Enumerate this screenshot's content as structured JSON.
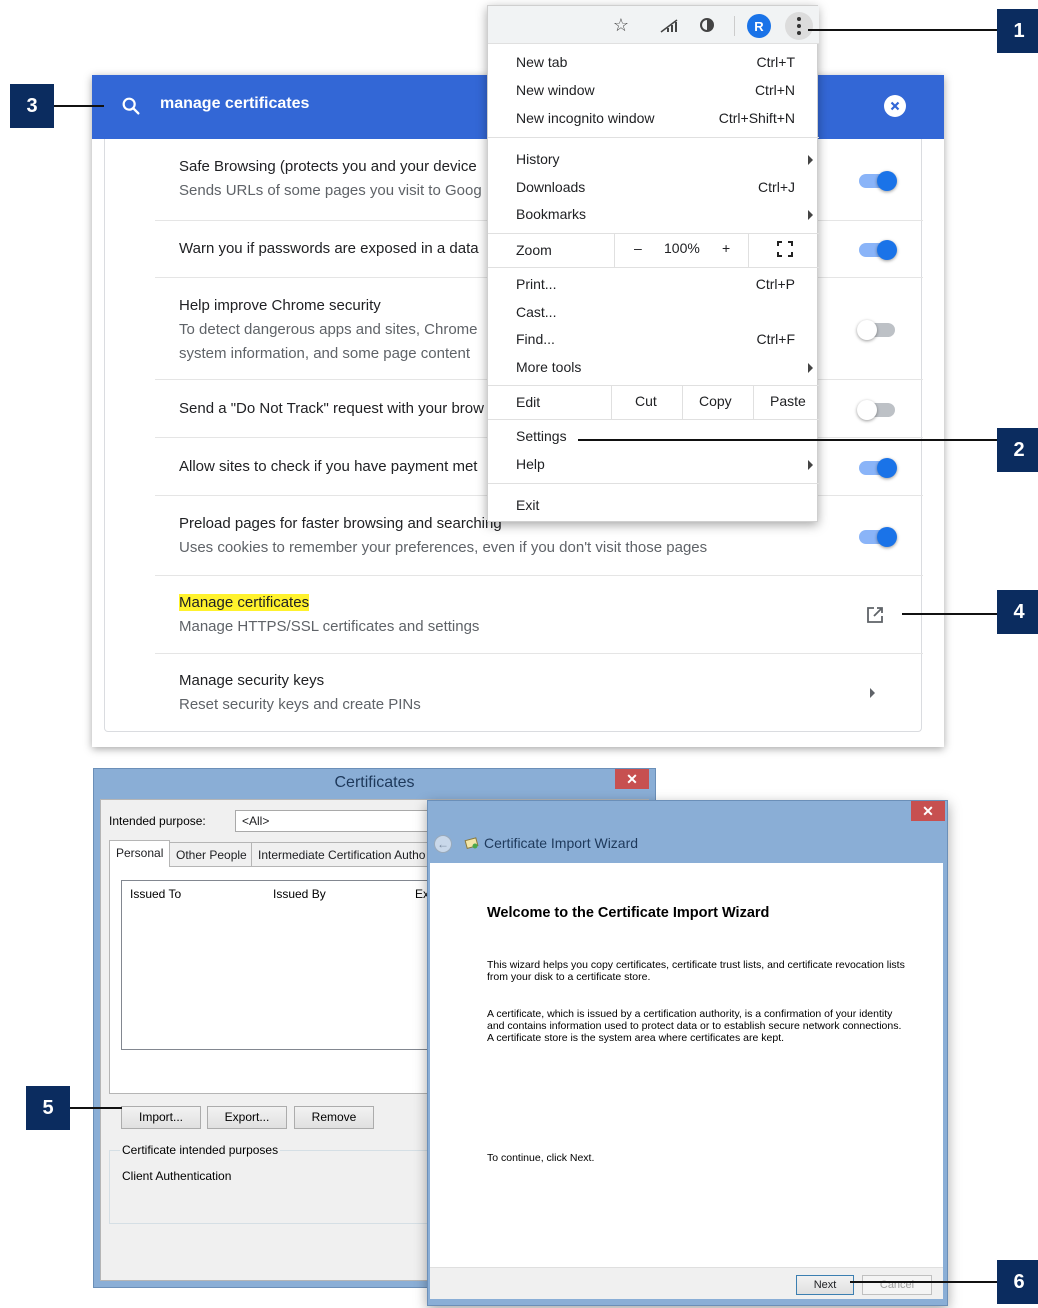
{
  "settings": {
    "search_query": "manage certificates",
    "rows": [
      {
        "title": "Safe Browsing (protects you and your device",
        "subtitle": "Sends URLs of some pages you visit to Goog"
      },
      {
        "title": "Warn you if passwords are exposed in a data"
      },
      {
        "title": "Help improve Chrome security",
        "subtitle": "To detect dangerous apps and sites, Chrome",
        "subtitle2": "system information, and some page content"
      },
      {
        "title": "Send a \"Do Not Track\" request with your brow"
      },
      {
        "title": "Allow sites to check if you have payment met"
      },
      {
        "title": "Preload pages for faster browsing and searching",
        "subtitle": "Uses cookies to remember your preferences, even if you don't visit those pages"
      },
      {
        "title": "Manage certificates",
        "subtitle": "Manage HTTPS/SSL certificates and settings"
      },
      {
        "title": "Manage security keys",
        "subtitle": "Reset security keys and create PINs"
      }
    ],
    "toggle_states": [
      "on",
      "on",
      "off",
      "off",
      "on",
      "on"
    ]
  },
  "menu": {
    "avatar_letter": "R",
    "new_tab": "New tab",
    "new_tab_shortcut": "Ctrl+T",
    "new_window": "New window",
    "new_window_shortcut": "Ctrl+N",
    "new_incognito": "New incognito window",
    "new_incognito_shortcut": "Ctrl+Shift+N",
    "history": "History",
    "downloads": "Downloads",
    "downloads_shortcut": "Ctrl+J",
    "bookmarks": "Bookmarks",
    "zoom": "Zoom",
    "zoom_minus": "–",
    "zoom_value": "100%",
    "zoom_plus": "+",
    "print": "Print...",
    "print_shortcut": "Ctrl+P",
    "cast": "Cast...",
    "find": "Find...",
    "find_shortcut": "Ctrl+F",
    "more_tools": "More tools",
    "edit": "Edit",
    "cut": "Cut",
    "copy": "Copy",
    "paste": "Paste",
    "settings": "Settings",
    "help": "Help",
    "exit": "Exit"
  },
  "callouts": [
    "1",
    "2",
    "3",
    "4",
    "5",
    "6"
  ],
  "certificates": {
    "title": "Certificates",
    "close": "✕",
    "intended_purpose_label": "Intended purpose:",
    "intended_purpose_value": "<All>",
    "tabs": [
      "Personal",
      "Other People",
      "Intermediate Certification Autho"
    ],
    "columns": [
      "Issued To",
      "Issued By",
      "Ex"
    ],
    "import": "Import...",
    "export": "Export...",
    "remove": "Remove",
    "purposes_label": "Certificate intended purposes",
    "purposes_value": "Client Authentication"
  },
  "wizard": {
    "title": "Certificate Import Wizard",
    "close": "✕",
    "heading": "Welcome to the Certificate Import Wizard",
    "para1": "This wizard helps you copy certificates, certificate trust lists, and certificate revocation lists from your disk to a certificate store.",
    "para2": "A certificate, which is issued by a certification authority, is a confirmation of your identity and contains information used to protect data or to establish secure network connections. A certificate store is the system area where certificates are kept.",
    "continue": "To continue, click Next.",
    "next": "Next",
    "cancel": "Cancel"
  }
}
